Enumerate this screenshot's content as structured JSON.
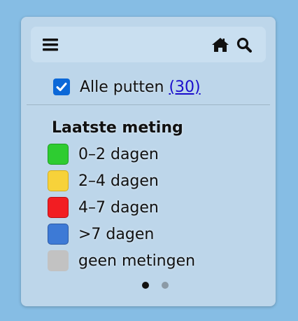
{
  "toolbar": {
    "menu_icon": "menu-icon",
    "home_icon": "home-icon",
    "search_icon": "search-icon"
  },
  "filter": {
    "checked": true,
    "label": "Alle putten",
    "count": "(30)"
  },
  "legend": {
    "title": "Laatste meting",
    "items": [
      {
        "label": "0–2 dagen",
        "color": "#2ecc31",
        "border": "#1f9e23"
      },
      {
        "label": "2–4 dagen",
        "color": "#f7d23a",
        "border": "#d6ad1d"
      },
      {
        "label": "4–7 dagen",
        "color": "#f21d22",
        "border": "#b81015"
      },
      {
        "label": ">7 dagen",
        "color": "#3d7ad6",
        "border": "#2b5aa6"
      },
      {
        "label": "geen metingen",
        "color": "#c2c2c2",
        "border": "#c2c2c2"
      }
    ]
  },
  "pagination": {
    "active_page": 1,
    "total_pages": 2,
    "active_color": "#111111",
    "inactive_color": "#8b9aa6"
  }
}
